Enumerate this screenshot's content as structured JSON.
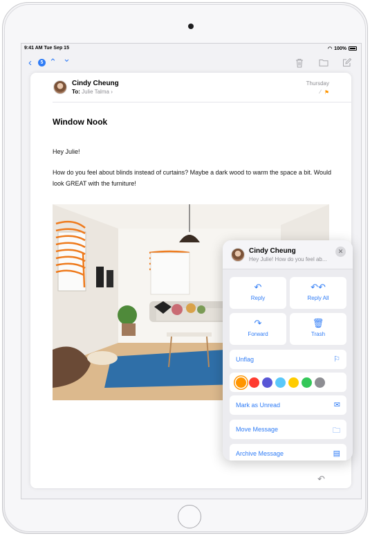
{
  "status_bar": {
    "time": "9:41 AM  Tue Sep 15",
    "battery": "100%"
  },
  "toolbar": {
    "unread_count": "5"
  },
  "message": {
    "sender": "Cindy Cheung",
    "to_label": "To:",
    "to_name": "Julie Talma",
    "date": "Thursday",
    "subject": "Window Nook",
    "greeting": "Hey Julie!",
    "paragraph": "How do you feel about blinds instead of curtains? Maybe a dark wood to warm the space a bit. Would look GREAT with the furniture!"
  },
  "popover": {
    "sender": "Cindy Cheung",
    "snippet": "Hey Julie! How do you feel ab...",
    "actions": [
      {
        "label": "Reply",
        "icon": "reply-icon"
      },
      {
        "label": "Reply All",
        "icon": "reply-all-icon"
      },
      {
        "label": "Forward",
        "icon": "forward-icon"
      },
      {
        "label": "Trash",
        "icon": "trash-icon"
      }
    ],
    "unflag_label": "Unflag",
    "flag_colors": [
      "#ff9500",
      "#ff3b30",
      "#5856d6",
      "#5ac8fa",
      "#ffcc00",
      "#34c759",
      "#8e8e93"
    ],
    "selected_color": "#ff9500",
    "mark_unread_label": "Mark as Unread",
    "move_label": "Move Message",
    "archive_label": "Archive Message"
  },
  "accent_color": "#2f7cf6"
}
